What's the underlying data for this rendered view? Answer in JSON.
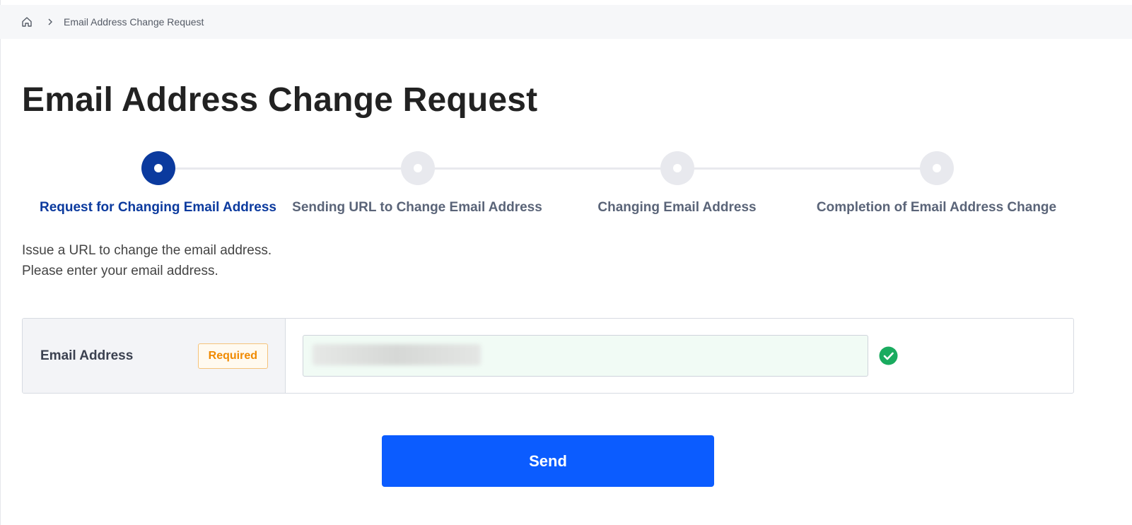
{
  "breadcrumb": {
    "home_icon": "home-icon",
    "separator_icon": "chevron-right-icon",
    "current": "Email Address Change Request"
  },
  "page_title": "Email Address Change Request",
  "stepper": {
    "steps": [
      {
        "label": "Request for Changing Email Address",
        "active": true
      },
      {
        "label": "Sending URL to Change Email Address",
        "active": false
      },
      {
        "label": "Changing Email Address",
        "active": false
      },
      {
        "label": "Completion of Email Address Change",
        "active": false
      }
    ]
  },
  "intro": {
    "line1": "Issue a URL to change the email address.",
    "line2": "Please enter your email address."
  },
  "form": {
    "email_label": "Email Address",
    "required_badge": "Required",
    "email_value": "",
    "valid_icon": "check-circle-icon"
  },
  "send_label": "Send",
  "colors": {
    "primary": "#0b5cff",
    "step_active": "#0b3a9e",
    "step_inactive": "#e8e9ee",
    "required": "#f08a00",
    "valid": "#1aab5f"
  }
}
